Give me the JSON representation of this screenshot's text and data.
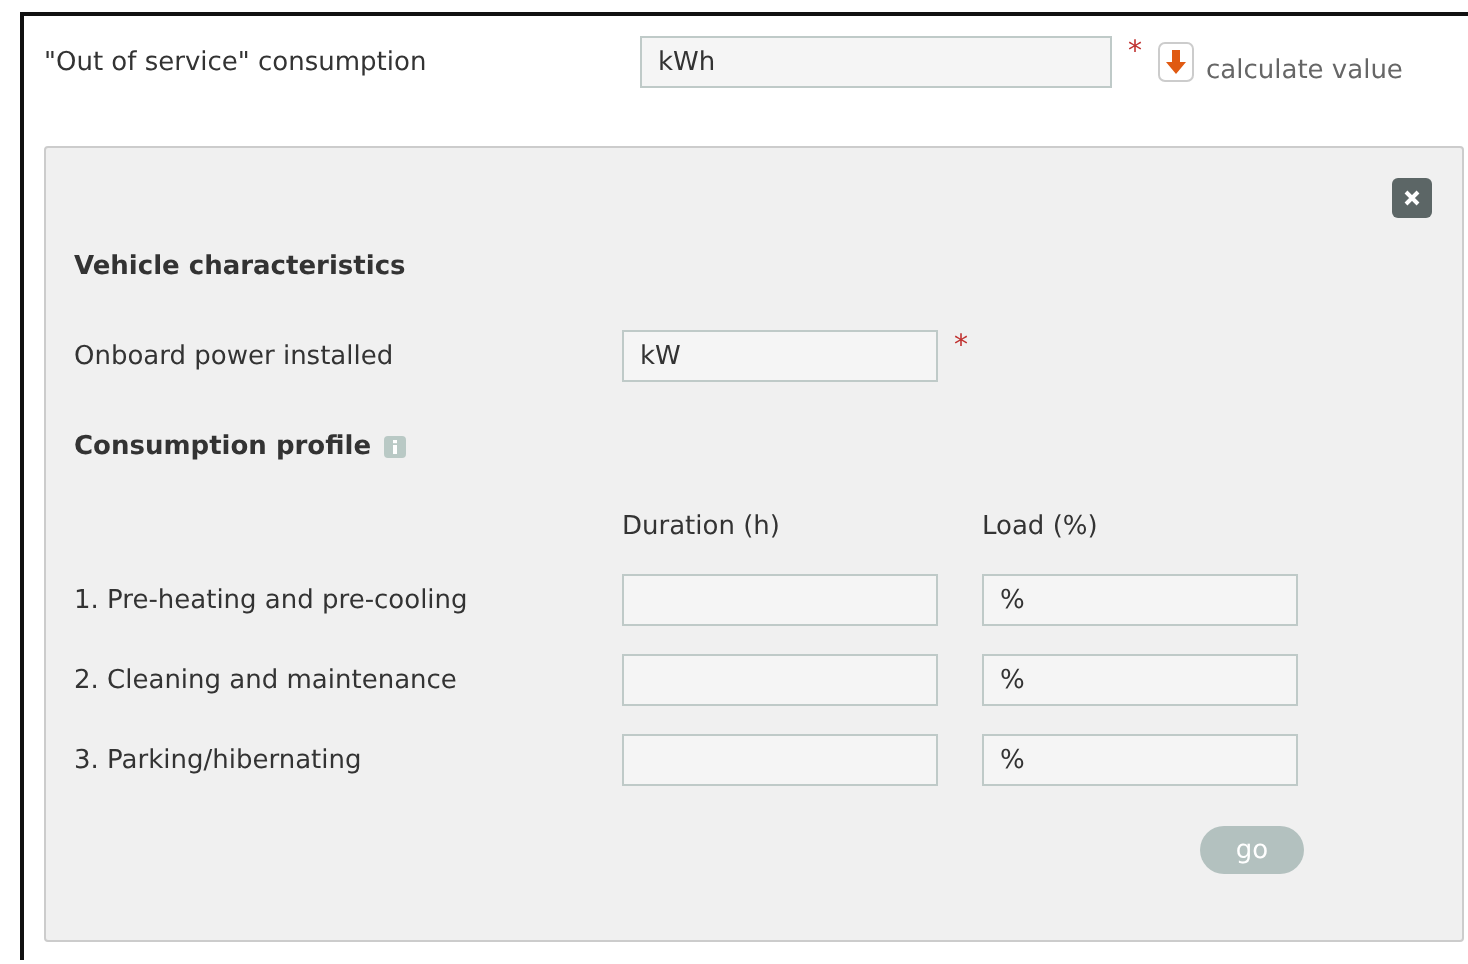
{
  "top_field": {
    "label": "\"Out of service\" consumption",
    "placeholder": "kWh",
    "required_mark": "*",
    "action": "calculate value"
  },
  "panel": {
    "sections": [
      {
        "title": "Vehicle characteristics"
      },
      {
        "title": "Consumption profile",
        "info": true
      }
    ],
    "onboard": {
      "label": "Onboard power installed",
      "placeholder": "kW",
      "required_mark": "*"
    },
    "columns": [
      "Duration (h)",
      "Load (%)"
    ],
    "rows": [
      {
        "label": "1. Pre-heating and pre-cooling",
        "load_placeholder": "%"
      },
      {
        "label": "2. Cleaning and maintenance",
        "load_placeholder": "%"
      },
      {
        "label": "3. Parking/hibernating",
        "load_placeholder": "%"
      }
    ],
    "go": {
      "label": "go",
      "disabled": true
    }
  }
}
